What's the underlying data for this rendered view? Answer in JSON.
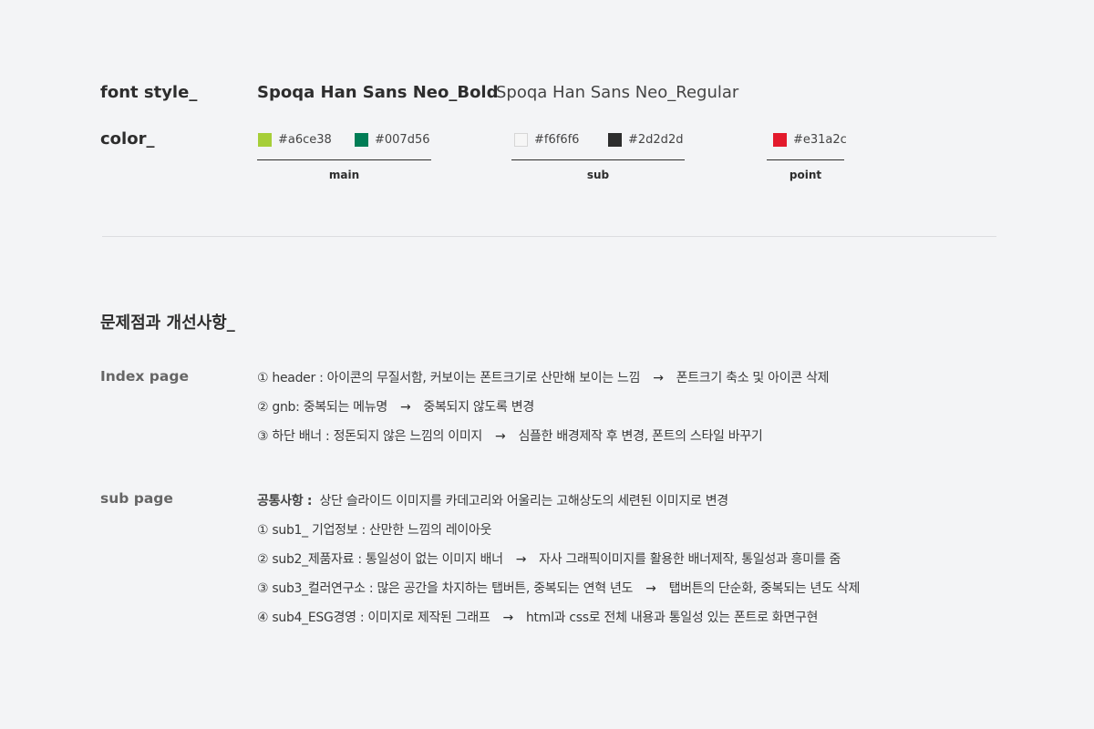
{
  "font_style": {
    "label": "font style_",
    "bold_name": "Spoqa Han Sans Neo_Bold",
    "regular_name": "Spoqa Han Sans Neo_Regular"
  },
  "color": {
    "label": "color_",
    "groups": [
      {
        "name": "main",
        "swatches": [
          {
            "hex": "#a6ce38"
          },
          {
            "hex": "#007d56"
          }
        ]
      },
      {
        "name": "sub",
        "swatches": [
          {
            "hex": "#f6f6f6"
          },
          {
            "hex": "#2d2d2d"
          }
        ]
      },
      {
        "name": "point",
        "swatches": [
          {
            "hex": "#e31a2c"
          }
        ]
      }
    ]
  },
  "issues": {
    "heading": "문제점과 개선사항_",
    "index_page": {
      "label": "Index page",
      "items": [
        {
          "text": "① header : 아이콘의 무질서함, 커보이는 폰트크기로 산만해 보이는 느낌",
          "arrow": "→",
          "result": "폰트크기 축소 및 아이콘 삭제"
        },
        {
          "text": "② gnb: 중복되는 메뉴명",
          "arrow": "→",
          "result": "중복되지 않도록 변경"
        },
        {
          "text": "③ 하단 배너 : 정돈되지 않은 느낌의 이미지",
          "arrow": "→",
          "result": "심플한 배경제작 후 변경, 폰트의 스타일 바꾸기"
        }
      ]
    },
    "sub_page": {
      "label": "sub page",
      "common": {
        "title": "공통사항 :",
        "text": "상단 슬라이드 이미지를 카데고리와 어울리는 고해상도의 세련된 이미지로 변경"
      },
      "items": [
        {
          "text": "① sub1_ 기업정보 :  산만한 느낌의 레이아웃",
          "arrow": "",
          "result": ""
        },
        {
          "text": "② sub2_제품자료 : 통일성이 없는 이미지 배너",
          "arrow": "→",
          "result": "자사 그래픽이미지를 활용한 배너제작, 통일성과 흥미를 줌"
        },
        {
          "text": "③ sub3_컬러연구소 : 많은 공간을 차지하는 탭버튼, 중복되는 연혁 년도",
          "arrow": "→",
          "result": "탭버튼의 단순화, 중복되는 년도 삭제"
        },
        {
          "text": "④ sub4_ESG경영 : 이미지로 제작된 그래프",
          "arrow": "→",
          "result": "html과 css로 전체 내용과 통일성 있는 폰트로 화면구현"
        }
      ]
    }
  }
}
